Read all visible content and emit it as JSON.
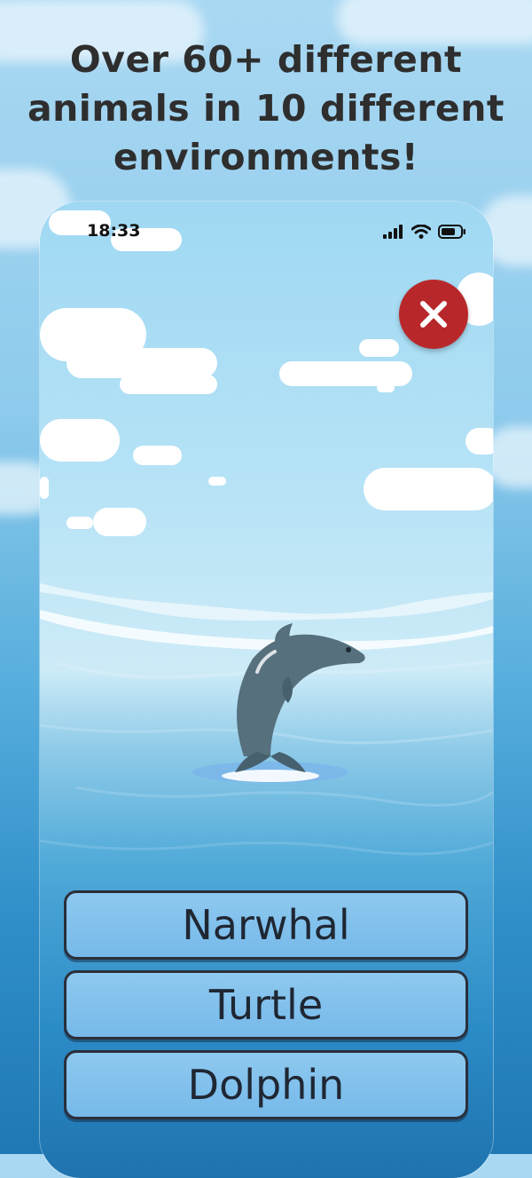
{
  "headline": {
    "line1": "Over 60+ different",
    "line2": "animals in 10 different",
    "line3": "environments!"
  },
  "status_bar": {
    "time": "18:33",
    "icons": [
      "signal-icon",
      "wifi-icon",
      "battery-icon"
    ]
  },
  "quiz": {
    "close_icon": "close-icon",
    "animal_image": "dolphin",
    "options": [
      "Narwhal",
      "Turtle",
      "Dolphin"
    ]
  },
  "colors": {
    "close_button": "#b8282b",
    "answer_button": "#7fbfec",
    "answer_border": "#2a2f3a",
    "headline_text": "#2e2e2e"
  }
}
